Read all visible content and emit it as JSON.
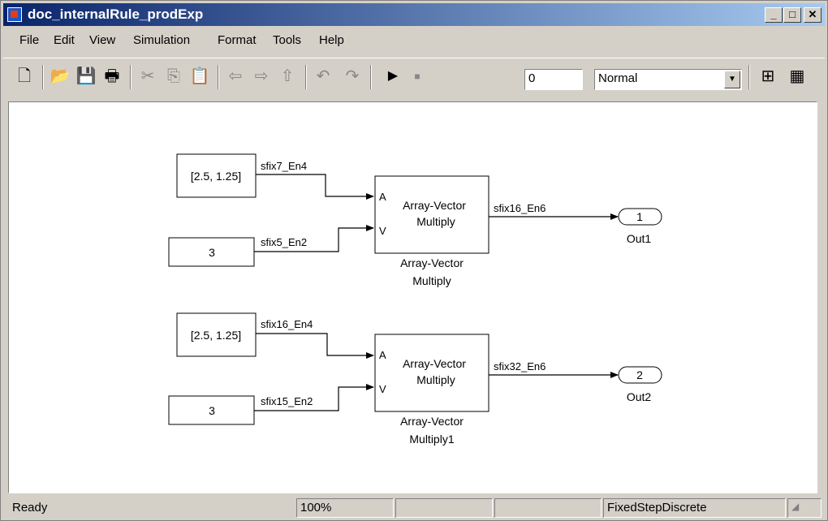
{
  "window": {
    "title": "doc_internalRule_prodExp"
  },
  "menu": [
    "File",
    "Edit",
    "View",
    "Simulation",
    "Format",
    "Tools",
    "Help"
  ],
  "toolbar": {
    "stop_time": "0",
    "sim_mode": "Normal",
    "icons": [
      "new-model-icon",
      "open-icon",
      "save-icon",
      "print-icon",
      "cut-icon",
      "copy-icon",
      "paste-icon",
      "back-icon",
      "forward-icon",
      "up-icon",
      "undo-icon",
      "redo-icon",
      "start-simulation-icon",
      "stop-simulation-icon",
      "build-icon",
      "library-browser-icon"
    ]
  },
  "diagram": {
    "const1": "[2.5, 1.25]",
    "const2": "3",
    "const3": "[2.5, 1.25]",
    "const4": "3",
    "sig1": "sfix7_En4",
    "sig2": "sfix5_En2",
    "sig3": "sfix16_En6",
    "sig4": "sfix16_En4",
    "sig5": "sfix15_En2",
    "sig6": "sfix32_En6",
    "port_a": "A",
    "port_v": "V",
    "block_line1": "Array-Vector",
    "block_line2": "Multiply",
    "block1_name1": "Array-Vector",
    "block1_name2": "Multiply",
    "block2_name1": "Array-Vector",
    "block2_name2": "Multiply1",
    "out1_num": "1",
    "out1_name": "Out1",
    "out2_num": "2",
    "out2_name": "Out2"
  },
  "status": {
    "state": "Ready",
    "zoom": "100%",
    "solver": "FixedStepDiscrete"
  }
}
